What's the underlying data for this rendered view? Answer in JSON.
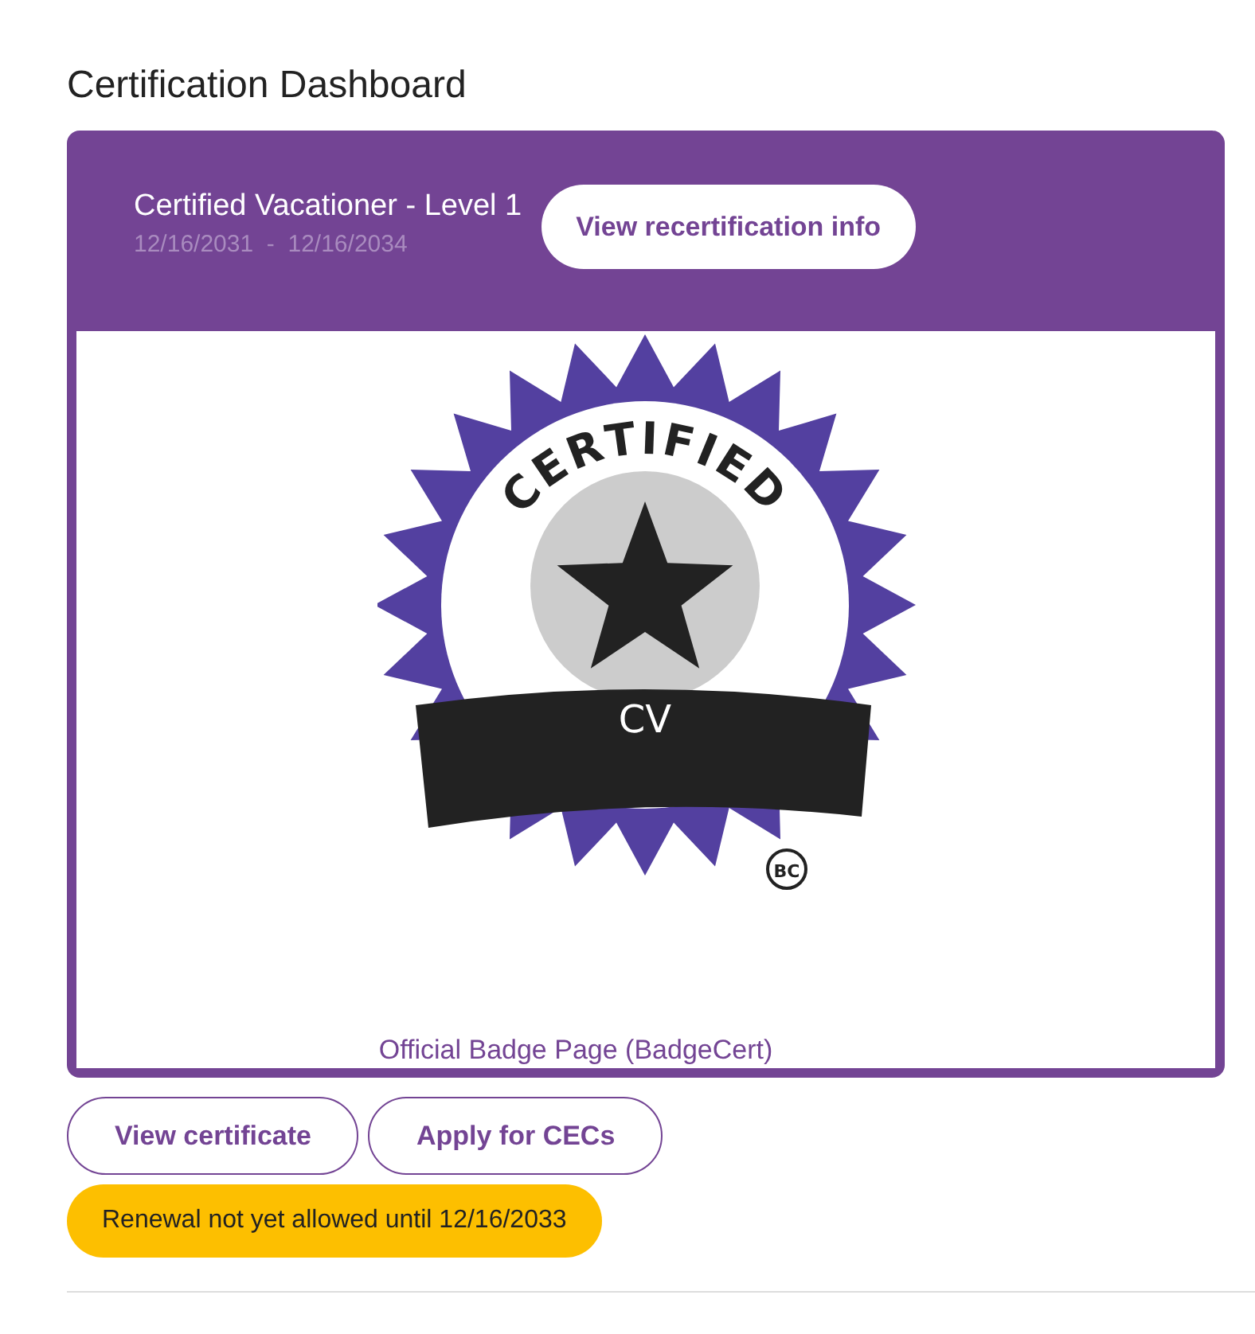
{
  "page_title": "Certification Dashboard",
  "certification": {
    "name": "Certified Vacationer - Level 1",
    "start_date": "12/16/2031",
    "date_separator": "-",
    "end_date": "12/16/2034",
    "header_button": "View recertification info",
    "badge": {
      "arc_text": "CERTIFIED",
      "code": "CV",
      "issuer_mark": "BC"
    },
    "badge_link": "Official Badge Page (BadgeCert)"
  },
  "actions": [
    "View certificate",
    "Apply for CECs"
  ],
  "renewal_notice": "Renewal not yet allowed until 12/16/2033"
}
